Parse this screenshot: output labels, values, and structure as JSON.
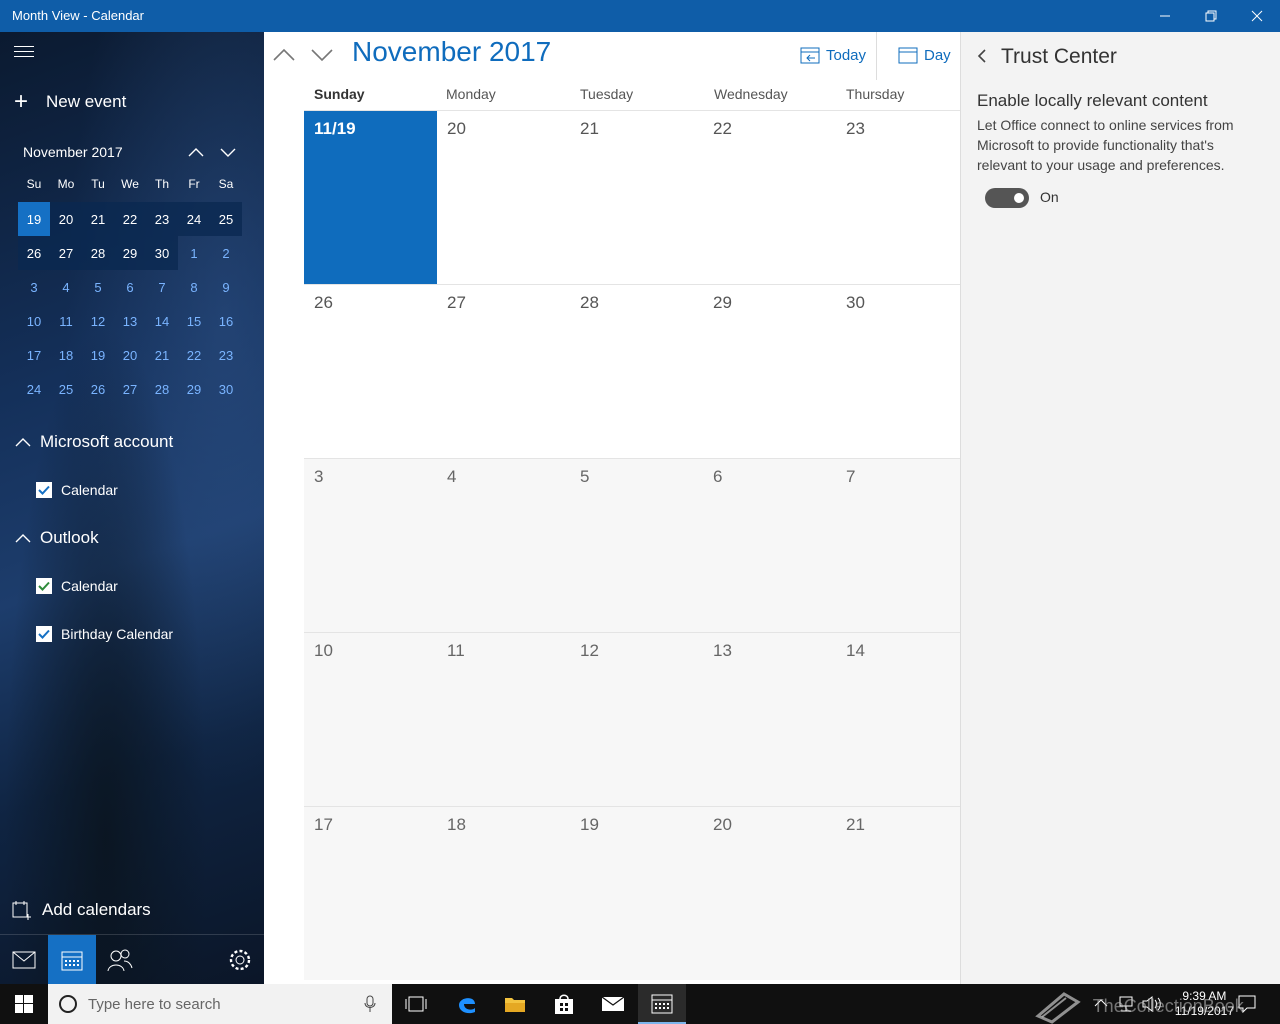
{
  "window": {
    "title": "Month View - Calendar"
  },
  "sidebar": {
    "new_event": "New event",
    "mini_calendar": {
      "header": "November 2017",
      "dow": [
        "Su",
        "Mo",
        "Tu",
        "We",
        "Th",
        "Fr",
        "Sa"
      ],
      "weeks": [
        [
          "19",
          "20",
          "21",
          "22",
          "23",
          "24",
          "25"
        ],
        [
          "26",
          "27",
          "28",
          "29",
          "30",
          "1",
          "2"
        ],
        [
          "3",
          "4",
          "5",
          "6",
          "7",
          "8",
          "9"
        ],
        [
          "10",
          "11",
          "12",
          "13",
          "14",
          "15",
          "16"
        ],
        [
          "17",
          "18",
          "19",
          "20",
          "21",
          "22",
          "23"
        ],
        [
          "24",
          "25",
          "26",
          "27",
          "28",
          "29",
          "30"
        ]
      ],
      "selected": "19"
    },
    "groups": [
      {
        "label": "Microsoft account",
        "items": [
          {
            "label": "Calendar",
            "checked": true,
            "color": "#1570c4"
          }
        ]
      },
      {
        "label": "Outlook",
        "items": [
          {
            "label": "Calendar",
            "checked": true,
            "color": "#2e8b3a"
          },
          {
            "label": "Birthday Calendar",
            "checked": true,
            "color": "#1570c4"
          }
        ]
      }
    ],
    "add_calendars": "Add calendars"
  },
  "main": {
    "month_title": "November 2017",
    "today_label": "Today",
    "view_label": "Day",
    "days_of_week": [
      "Sunday",
      "Monday",
      "Tuesday",
      "Wednesday",
      "Thursday"
    ],
    "weeks": [
      [
        "11/19",
        "20",
        "21",
        "22",
        "23"
      ],
      [
        "26",
        "27",
        "28",
        "29",
        "30"
      ],
      [
        "3",
        "4",
        "5",
        "6",
        "7"
      ],
      [
        "10",
        "11",
        "12",
        "13",
        "14"
      ],
      [
        "17",
        "18",
        "19",
        "20",
        "21"
      ]
    ]
  },
  "trust_center": {
    "title": "Trust Center",
    "heading": "Enable locally relevant content",
    "description": "Let Office connect to online services from Microsoft to provide functionality that's relevant to your usage and preferences.",
    "toggle_label": "On",
    "toggle_on": true
  },
  "taskbar": {
    "search_placeholder": "Type here to search",
    "time": "9:39 AM",
    "date": "11/19/2017"
  },
  "watermark": "TheCollectionBook",
  "colors": {
    "accent": "#0f6cbd",
    "titlebar": "#0f5da8"
  }
}
